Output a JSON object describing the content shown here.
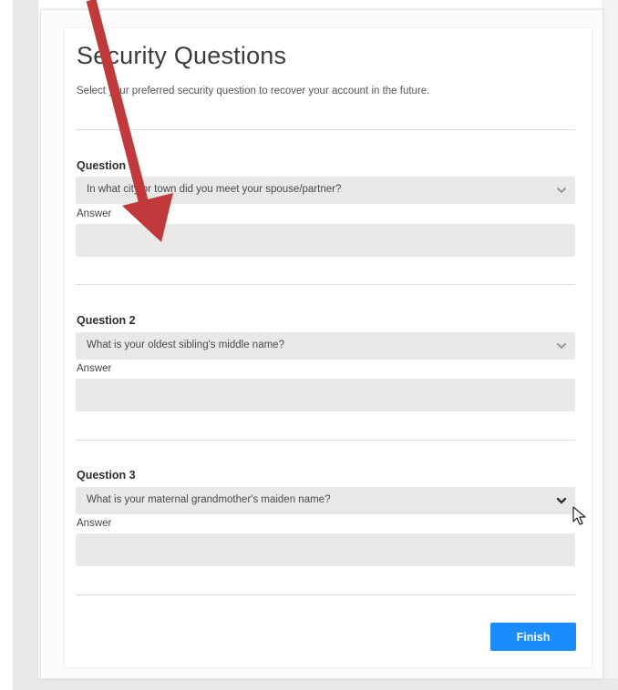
{
  "page": {
    "title": "Security Questions",
    "subtitle": "Select your preferred security question to recover your account in the future."
  },
  "questions": [
    {
      "label": "Question 1",
      "selected": "In what city or town did you meet your spouse/partner?",
      "answer_label": "Answer",
      "answer_value": ""
    },
    {
      "label": "Question 2",
      "selected": "What is your oldest sibling's middle name?",
      "answer_label": "Answer",
      "answer_value": ""
    },
    {
      "label": "Question 3",
      "selected": "What is your maternal grandmother's maiden name?",
      "answer_label": "Answer",
      "answer_value": ""
    }
  ],
  "actions": {
    "finish_label": "Finish"
  },
  "colors": {
    "accent": "#1a8cff",
    "annotation_arrow": "#c0393b",
    "field_bg": "#e8e8e8"
  },
  "icons": {
    "dropdown": "chevron-down-icon",
    "pointer": "mouse-cursor-icon",
    "annotation": "annotation-arrow-icon"
  }
}
